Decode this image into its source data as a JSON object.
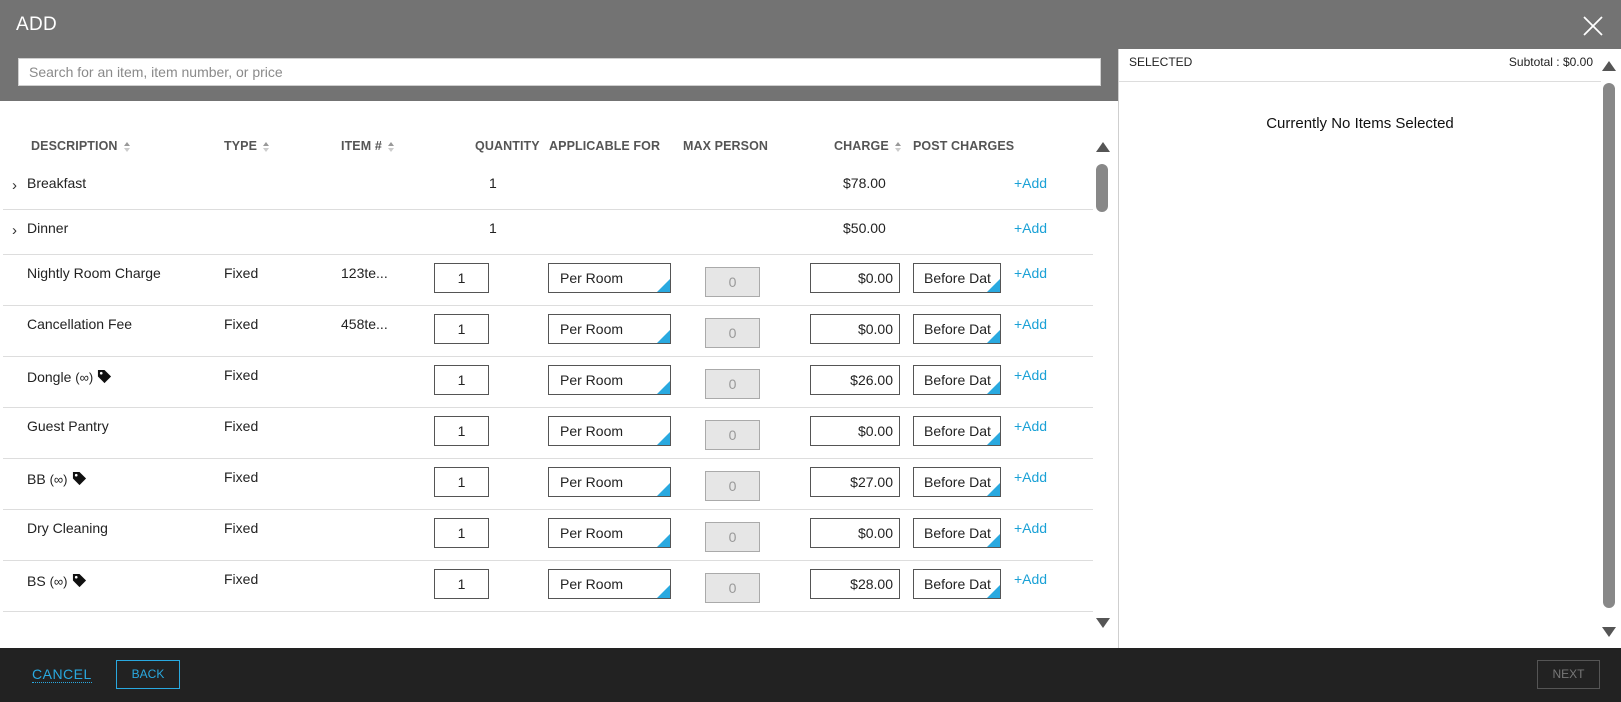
{
  "dialog": {
    "title": "ADD"
  },
  "search": {
    "placeholder": "Search for an item, item number, or price"
  },
  "columns": {
    "description": "DESCRIPTION",
    "type": "TYPE",
    "item": "ITEM #",
    "quantity": "QUANTITY",
    "applicable": "APPLICABLE FOR",
    "max_person": "MAX PERSON",
    "charge": "CHARGE",
    "post": "POST CHARGES"
  },
  "groups": [
    {
      "label": "Breakfast",
      "quantity": "1",
      "charge": "$78.00",
      "add": "+Add"
    },
    {
      "label": "Dinner",
      "quantity": "1",
      "charge": "$50.00",
      "add": "+Add"
    }
  ],
  "items": [
    {
      "description": "Nightly Room Charge",
      "type": "Fixed",
      "item": "123te...",
      "quantity": "1",
      "applicable": "Per Room",
      "max_person": "0",
      "charge": "$0.00",
      "post": "Before Dat",
      "add": "+Add"
    },
    {
      "description": "Cancellation Fee",
      "type": "Fixed",
      "item": "458te...",
      "quantity": "1",
      "applicable": "Per Room",
      "max_person": "0",
      "charge": "$0.00",
      "post": "Before Dat",
      "add": "+Add"
    },
    {
      "description": "Dongle",
      "infinity": "(∞)",
      "type": "Fixed",
      "item": "",
      "quantity": "1",
      "applicable": "Per Room",
      "max_person": "0",
      "charge": "$26.00",
      "post": "Before Dat",
      "add": "+Add"
    },
    {
      "description": "Guest Pantry",
      "type": "Fixed",
      "item": "",
      "quantity": "1",
      "applicable": "Per Room",
      "max_person": "0",
      "charge": "$0.00",
      "post": "Before Dat",
      "add": "+Add"
    },
    {
      "description": "BB",
      "infinity": "(∞)",
      "type": "Fixed",
      "item": "",
      "quantity": "1",
      "applicable": "Per Room",
      "max_person": "0",
      "charge": "$27.00",
      "post": "Before Dat",
      "add": "+Add"
    },
    {
      "description": "Dry Cleaning",
      "type": "Fixed",
      "item": "",
      "quantity": "1",
      "applicable": "Per Room",
      "max_person": "0",
      "charge": "$0.00",
      "post": "Before Dat",
      "add": "+Add"
    },
    {
      "description": "BS",
      "infinity": "(∞)",
      "type": "Fixed",
      "item": "",
      "quantity": "1",
      "applicable": "Per Room",
      "max_person": "0",
      "charge": "$28.00",
      "post": "Before Dat",
      "add": "+Add"
    }
  ],
  "selected_panel": {
    "title": "SELECTED",
    "subtotal": "Subtotal : $0.00",
    "empty_message": "Currently No Items Selected"
  },
  "footer": {
    "cancel": "CANCEL",
    "back": "BACK",
    "next": "NEXT"
  },
  "colors": {
    "accent": "#29a9e0",
    "header": "#737373",
    "footer": "#222222"
  }
}
